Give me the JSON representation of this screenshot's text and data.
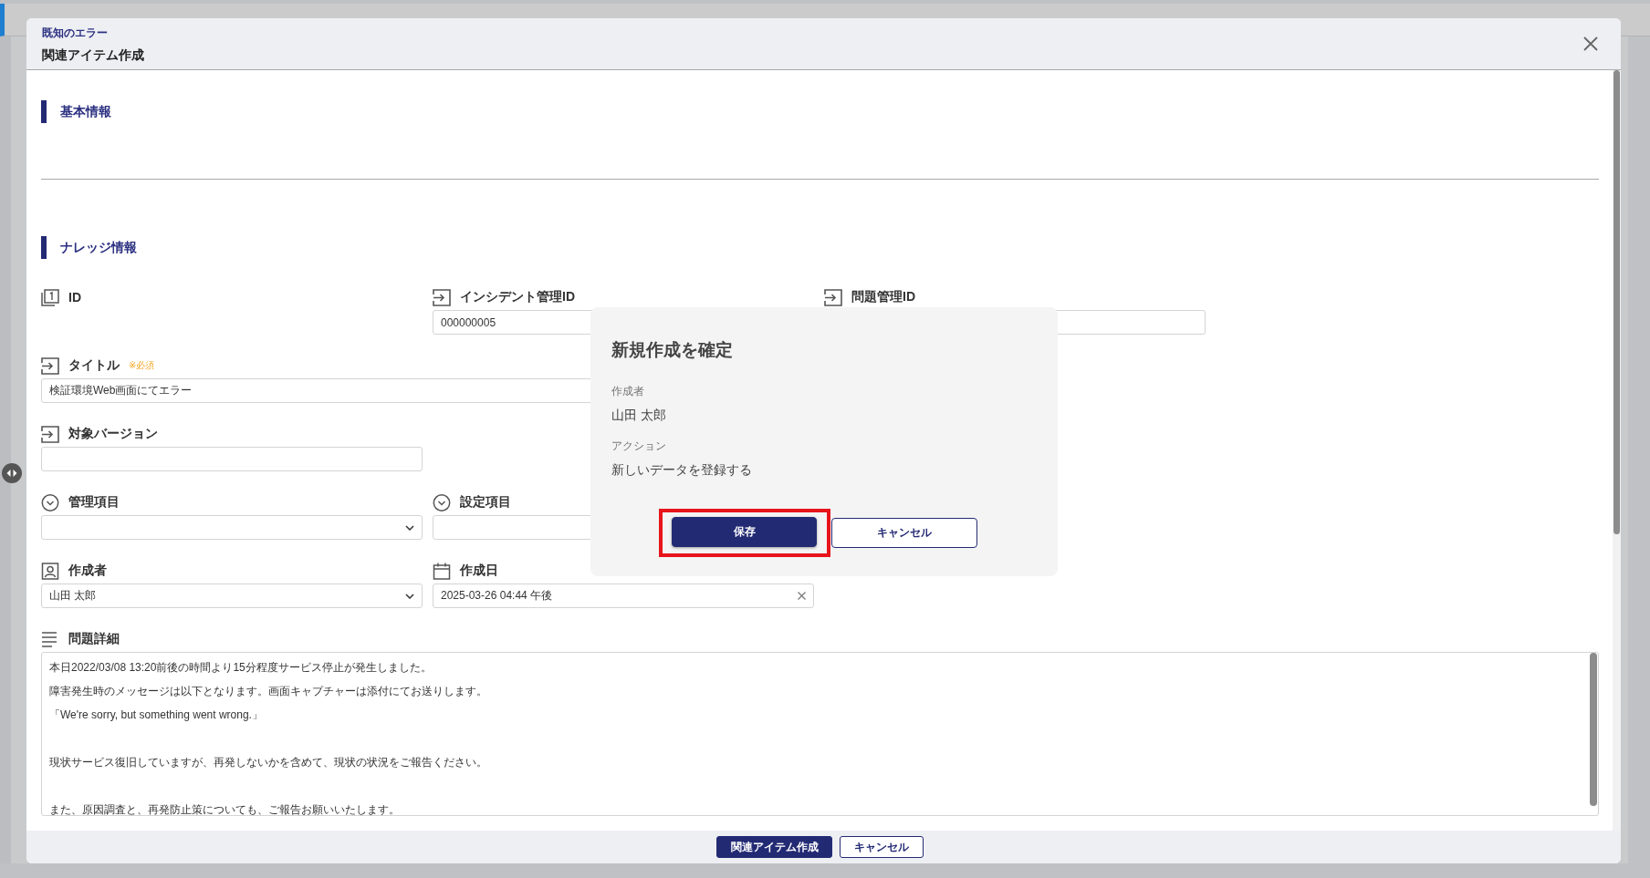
{
  "modal": {
    "breadcrumb": "既知のエラー",
    "title": "関連アイテム作成"
  },
  "sections": [
    {
      "title": "基本情報"
    },
    {
      "title": "ナレッジ情報"
    }
  ],
  "rows": [
    [
      {
        "label": "ID",
        "kind": "id"
      },
      {
        "label": "インシデント管理ID",
        "kind": "text",
        "value": "000000005"
      },
      {
        "label": "問題管理ID",
        "kind": "text"
      }
    ],
    [
      {
        "label": "タイトル",
        "kind": "text",
        "required_note": "※必須",
        "value": "検証環境Web画面にてエラー"
      }
    ],
    [
      {
        "label": "対象バージョン",
        "kind": "text"
      }
    ],
    [
      {
        "label": "管理項目",
        "kind": "select"
      },
      {
        "label": "設定項目",
        "kind": "select"
      }
    ],
    [
      {
        "label": "作成者",
        "kind": "user",
        "value": "山田 太郎"
      },
      {
        "label": "作成日",
        "kind": "date",
        "value": "2025-03-26 04:44 午後"
      }
    ],
    [
      {
        "label": "問題詳細",
        "kind": "textarea",
        "paragraphs": [
          [
            "本日2022/03/08 13:20前後の時間より15分程度サービス停止が発生しました。",
            "障害発生時のメッセージは以下となります。画面キャプチャーは添付にてお送りします。",
            "「We're sorry, but something went wrong.」"
          ],
          [
            "現状サービス復旧していますが、再発しないかを含めて、現状の状況をご報告ください。"
          ],
          [
            "また、原因調査と、再発防止策についても、ご報告お願いいたします。"
          ]
        ]
      }
    ]
  ],
  "confirm_dialog": {
    "title": "新規作成を確定",
    "details": [
      {
        "label": "作成者",
        "value": "山田 太郎"
      },
      {
        "label": "アクション",
        "value": "新しいデータを登録する"
      }
    ],
    "buttons": [
      {
        "label": "保存",
        "kind": "primary",
        "highlighted": true
      },
      {
        "label": "キャンセル",
        "kind": "secondary",
        "highlighted": false
      }
    ]
  },
  "footer": {
    "buttons": [
      {
        "label": "関連アイテム作成",
        "kind": "primary"
      },
      {
        "label": "キャンセル",
        "kind": "secondary"
      }
    ]
  }
}
